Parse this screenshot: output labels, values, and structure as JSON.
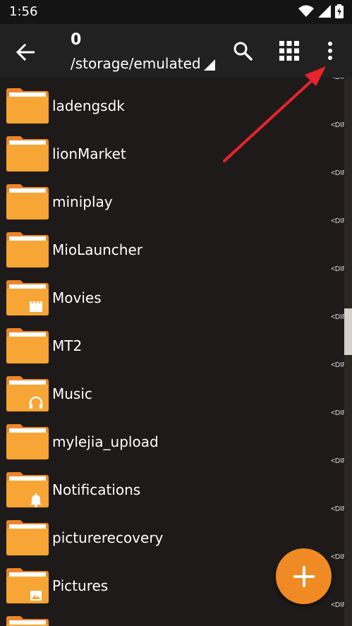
{
  "status_bar": {
    "time": "1:56",
    "icons": [
      "wifi-icon",
      "signal-icon",
      "battery-charging-icon"
    ]
  },
  "toolbar": {
    "title": "0",
    "path": "/storage/emulated",
    "icons": [
      "back-arrow-icon",
      "search-icon",
      "grid-view-icon",
      "more-vert-icon"
    ]
  },
  "colors": {
    "folder": "#f7a534",
    "folder_dark": "#e8892a",
    "fab": "#f08a24",
    "background": "#1e1a19",
    "toolbar": "#212121",
    "annotation_arrow": "#e8232c"
  },
  "dir_label": "<DIR>",
  "files": [
    {
      "name": "ladengsdk",
      "badge": ""
    },
    {
      "name": "lionMarket",
      "badge": ""
    },
    {
      "name": "miniplay",
      "badge": ""
    },
    {
      "name": "MioLauncher",
      "badge": ""
    },
    {
      "name": "Movies",
      "badge": "movie-icon"
    },
    {
      "name": "MT2",
      "badge": ""
    },
    {
      "name": "Music",
      "badge": "headphones-icon"
    },
    {
      "name": "mylejia_upload",
      "badge": ""
    },
    {
      "name": "Notifications",
      "badge": "bell-icon"
    },
    {
      "name": "picturerecovery",
      "badge": ""
    },
    {
      "name": "Pictures",
      "badge": "image-icon"
    }
  ],
  "fab": {
    "icon": "plus-icon"
  }
}
